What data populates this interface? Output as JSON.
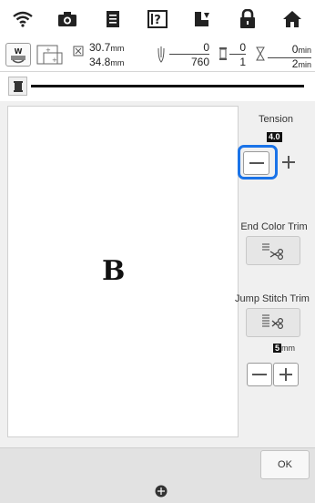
{
  "info_bar": {
    "width_value": "30.7",
    "height_value": "34.8",
    "unit_mm": "mm",
    "stitch_current": "0",
    "stitch_total": "760",
    "color_current": "0",
    "color_total": "1",
    "time_current": "0",
    "time_total": "2",
    "unit_min": "min"
  },
  "canvas": {
    "letter": "B"
  },
  "right_panel": {
    "tension_label": "Tension",
    "tension_value": "4.0",
    "end_color_trim_label": "End Color Trim",
    "jump_stitch_trim_label": "Jump Stitch Trim",
    "jump_length_value": "5",
    "jump_length_unit": "mm"
  },
  "footer": {
    "ok_label": "OK"
  },
  "colors": {
    "highlight": "#1a73e8",
    "thread_line": "#111111",
    "panel_bg": "#f0f0f0"
  }
}
